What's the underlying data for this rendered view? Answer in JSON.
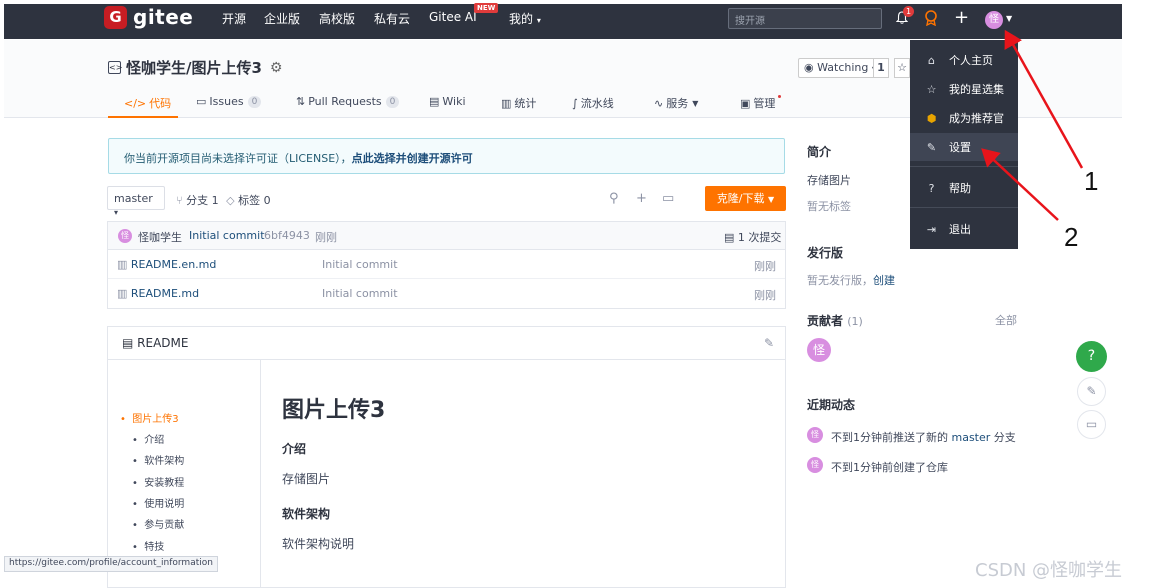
{
  "navbar": {
    "logo_mark": "G",
    "logo_text": "gitee",
    "items": [
      "开源",
      "企业版",
      "高校版",
      "私有云",
      "Gitee AI",
      "我的"
    ],
    "new_badge": "NEW",
    "search_placeholder": "搜开源",
    "notification_count": "1",
    "avatar_letter": "怪"
  },
  "repo": {
    "title": "怪咖学生/图片上传3",
    "watch_label": "Watching",
    "watch_count": "1",
    "tabs": [
      {
        "label": "代码",
        "icon": "</>"
      },
      {
        "label": "Issues",
        "count": "0"
      },
      {
        "label": "Pull Requests",
        "count": "0"
      },
      {
        "label": "Wiki"
      },
      {
        "label": "统计"
      },
      {
        "label": "流水线"
      },
      {
        "label": "服务"
      },
      {
        "label": "管理"
      }
    ]
  },
  "license_notice": {
    "text": "你当前开源项目尚未选择许可证（LICENSE），",
    "link": "点此选择并创建开源许可"
  },
  "branch": {
    "name": "master",
    "branches": "分支 1",
    "tags": "标签 0",
    "clone_label": "克隆/下载"
  },
  "commit": {
    "author": "怪咖学生",
    "message": "Initial commit",
    "hash": "6bf4943",
    "time": "刚刚",
    "count": "1 次提交"
  },
  "files": [
    {
      "name": "README.en.md",
      "message": "Initial commit",
      "time": "刚刚"
    },
    {
      "name": "README.md",
      "message": "Initial commit",
      "time": "刚刚"
    }
  ],
  "readme": {
    "label": "README",
    "toc": [
      "图片上传3",
      "介绍",
      "软件架构",
      "安装教程",
      "使用说明",
      "参与贡献",
      "特技"
    ],
    "title": "图片上传3",
    "h_intro": "介绍",
    "intro_text": "存储图片",
    "h_arch": "软件架构",
    "arch_text": "软件架构说明"
  },
  "sidebar": {
    "intro_title": "简介",
    "intro_desc": "存储图片",
    "no_tags": "暂无标签",
    "release_title": "发行版",
    "release_text": "暂无发行版，",
    "release_link": "创建",
    "contrib_title": "贡献者",
    "contrib_count": "(1)",
    "contrib_all": "全部",
    "activity_title": "近期动态",
    "activity": [
      {
        "text": "不到1分钟前推送了新的",
        "link": "master",
        "suffix": "分支"
      },
      {
        "text": "不到1分钟前创建了仓库"
      }
    ]
  },
  "dropdown": {
    "items": [
      {
        "label": "个人主页",
        "icon": "home-icon"
      },
      {
        "label": "我的星选集",
        "icon": "star-icon"
      },
      {
        "label": "成为推荐官",
        "icon": "badge-icon"
      },
      {
        "label": "设置",
        "icon": "settings-icon"
      },
      {
        "label": "帮助",
        "icon": "help-icon"
      },
      {
        "label": "退出",
        "icon": "logout-icon"
      }
    ]
  },
  "annotations": {
    "one": "1",
    "two": "2"
  },
  "status_url": "https://gitee.com/profile/account_information",
  "watermark": "CSDN @怪咖学生",
  "colors": {
    "navbar": "#2e333f",
    "accent": "#fe7300",
    "arrow": "#e8141b",
    "help": "#2fa94b"
  }
}
